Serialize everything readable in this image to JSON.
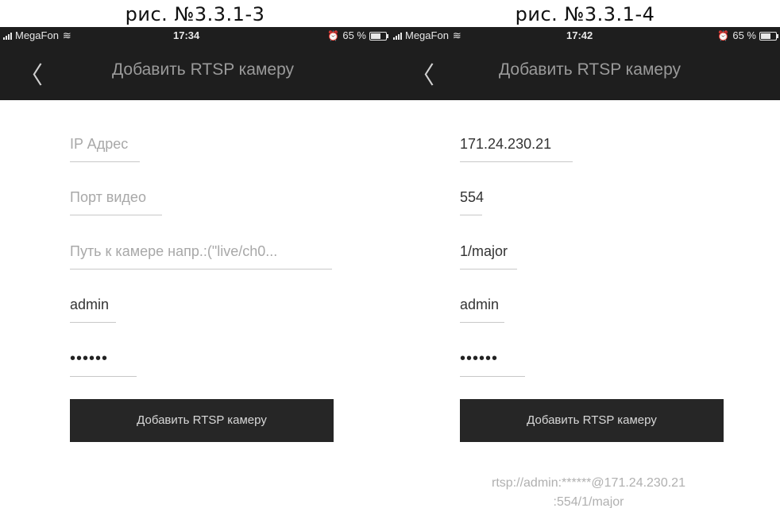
{
  "screens": [
    {
      "caption": "рис. №3.3.1-3",
      "status": {
        "carrier": "MegaFon",
        "time": "17:34",
        "battery": "65 %"
      },
      "title": "Добавить RTSP камеру",
      "fields": {
        "ip": {
          "value": "",
          "placeholder": "IP Адрес"
        },
        "port": {
          "value": "",
          "placeholder": "Порт видео"
        },
        "path": {
          "value": "",
          "placeholder": "Путь к камере напр.:(\"live/ch0..."
        },
        "user": {
          "value": "admin"
        },
        "password": {
          "value": "••••••"
        }
      },
      "button_label": "Добавить RTSP камеру"
    },
    {
      "caption": "рис. №3.3.1-4",
      "status": {
        "carrier": "MegaFon",
        "time": "17:42",
        "battery": "65 %"
      },
      "title": "Добавить RTSP камеру",
      "fields": {
        "ip": {
          "value": "171.24.230.21",
          "placeholder": "IP Адрес"
        },
        "port": {
          "value": "554",
          "placeholder": "Порт видео"
        },
        "path": {
          "value": "1/major",
          "placeholder": "Путь к камере напр.:(\"live/ch0..."
        },
        "user": {
          "value": "admin"
        },
        "password": {
          "value": "••••••"
        }
      },
      "button_label": "Добавить RTSP камеру",
      "url_line1": "rtsp://admin:******@171.24.230.21",
      "url_line2": ":554/1/major"
    }
  ],
  "icons": {
    "back": "chevron-left-icon",
    "wifi": "wifi-icon",
    "alarm": "alarm-icon",
    "battery": "battery-icon",
    "signal": "signal-icon"
  },
  "colors": {
    "bar_bg": "#1e1e1e",
    "button_bg": "#262626",
    "placeholder": "#a8a8a8"
  }
}
